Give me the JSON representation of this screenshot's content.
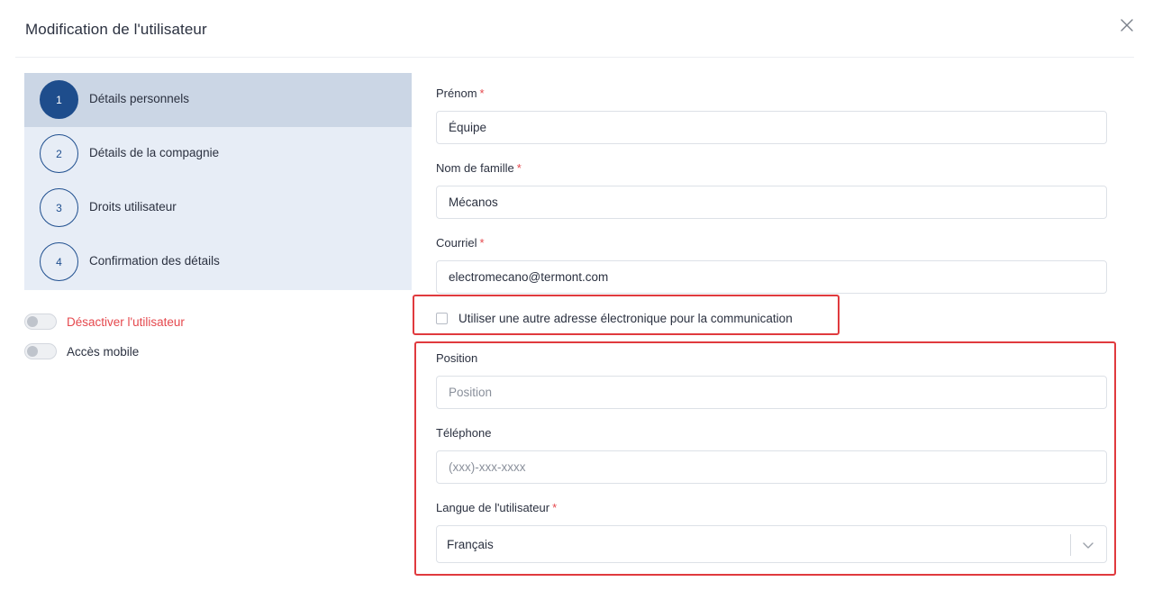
{
  "dialog": {
    "title": "Modification de l'utilisateur",
    "close_icon": "close-icon"
  },
  "stepper": {
    "steps": [
      {
        "number": "1",
        "label": "Détails personnels",
        "active": true
      },
      {
        "number": "2",
        "label": "Détails de la compagnie",
        "active": false
      },
      {
        "number": "3",
        "label": "Droits utilisateur",
        "active": false
      },
      {
        "number": "4",
        "label": "Confirmation des détails",
        "active": false
      }
    ]
  },
  "toggles": {
    "deactivate": {
      "label": "Désactiver l'utilisateur",
      "on": false
    },
    "mobile": {
      "label": "Accès mobile",
      "on": false
    }
  },
  "form": {
    "first_name": {
      "label": "Prénom",
      "required_mark": "*",
      "value": "Équipe"
    },
    "last_name": {
      "label": "Nom de famille",
      "required_mark": "*",
      "value": "Mécanos"
    },
    "email": {
      "label": "Courriel",
      "required_mark": "*",
      "value": "electromecano@termont.com"
    },
    "alt_email_checkbox": {
      "label": "Utiliser une autre adresse électronique pour la communication",
      "checked": false
    },
    "position": {
      "label": "Position",
      "value": "",
      "placeholder": "Position"
    },
    "phone": {
      "label": "Téléphone",
      "value": "",
      "placeholder": "(xxx)-xxx-xxxx"
    },
    "language": {
      "label": "Langue de l'utilisateur",
      "required_mark": "*",
      "value": "Français"
    }
  },
  "colors": {
    "accent": "#1e4d8c",
    "required": "#e5484d",
    "annotation": "#e03a3e",
    "stepper_bg": "#e7edf6",
    "stepper_active_bg": "#cbd6e5"
  }
}
